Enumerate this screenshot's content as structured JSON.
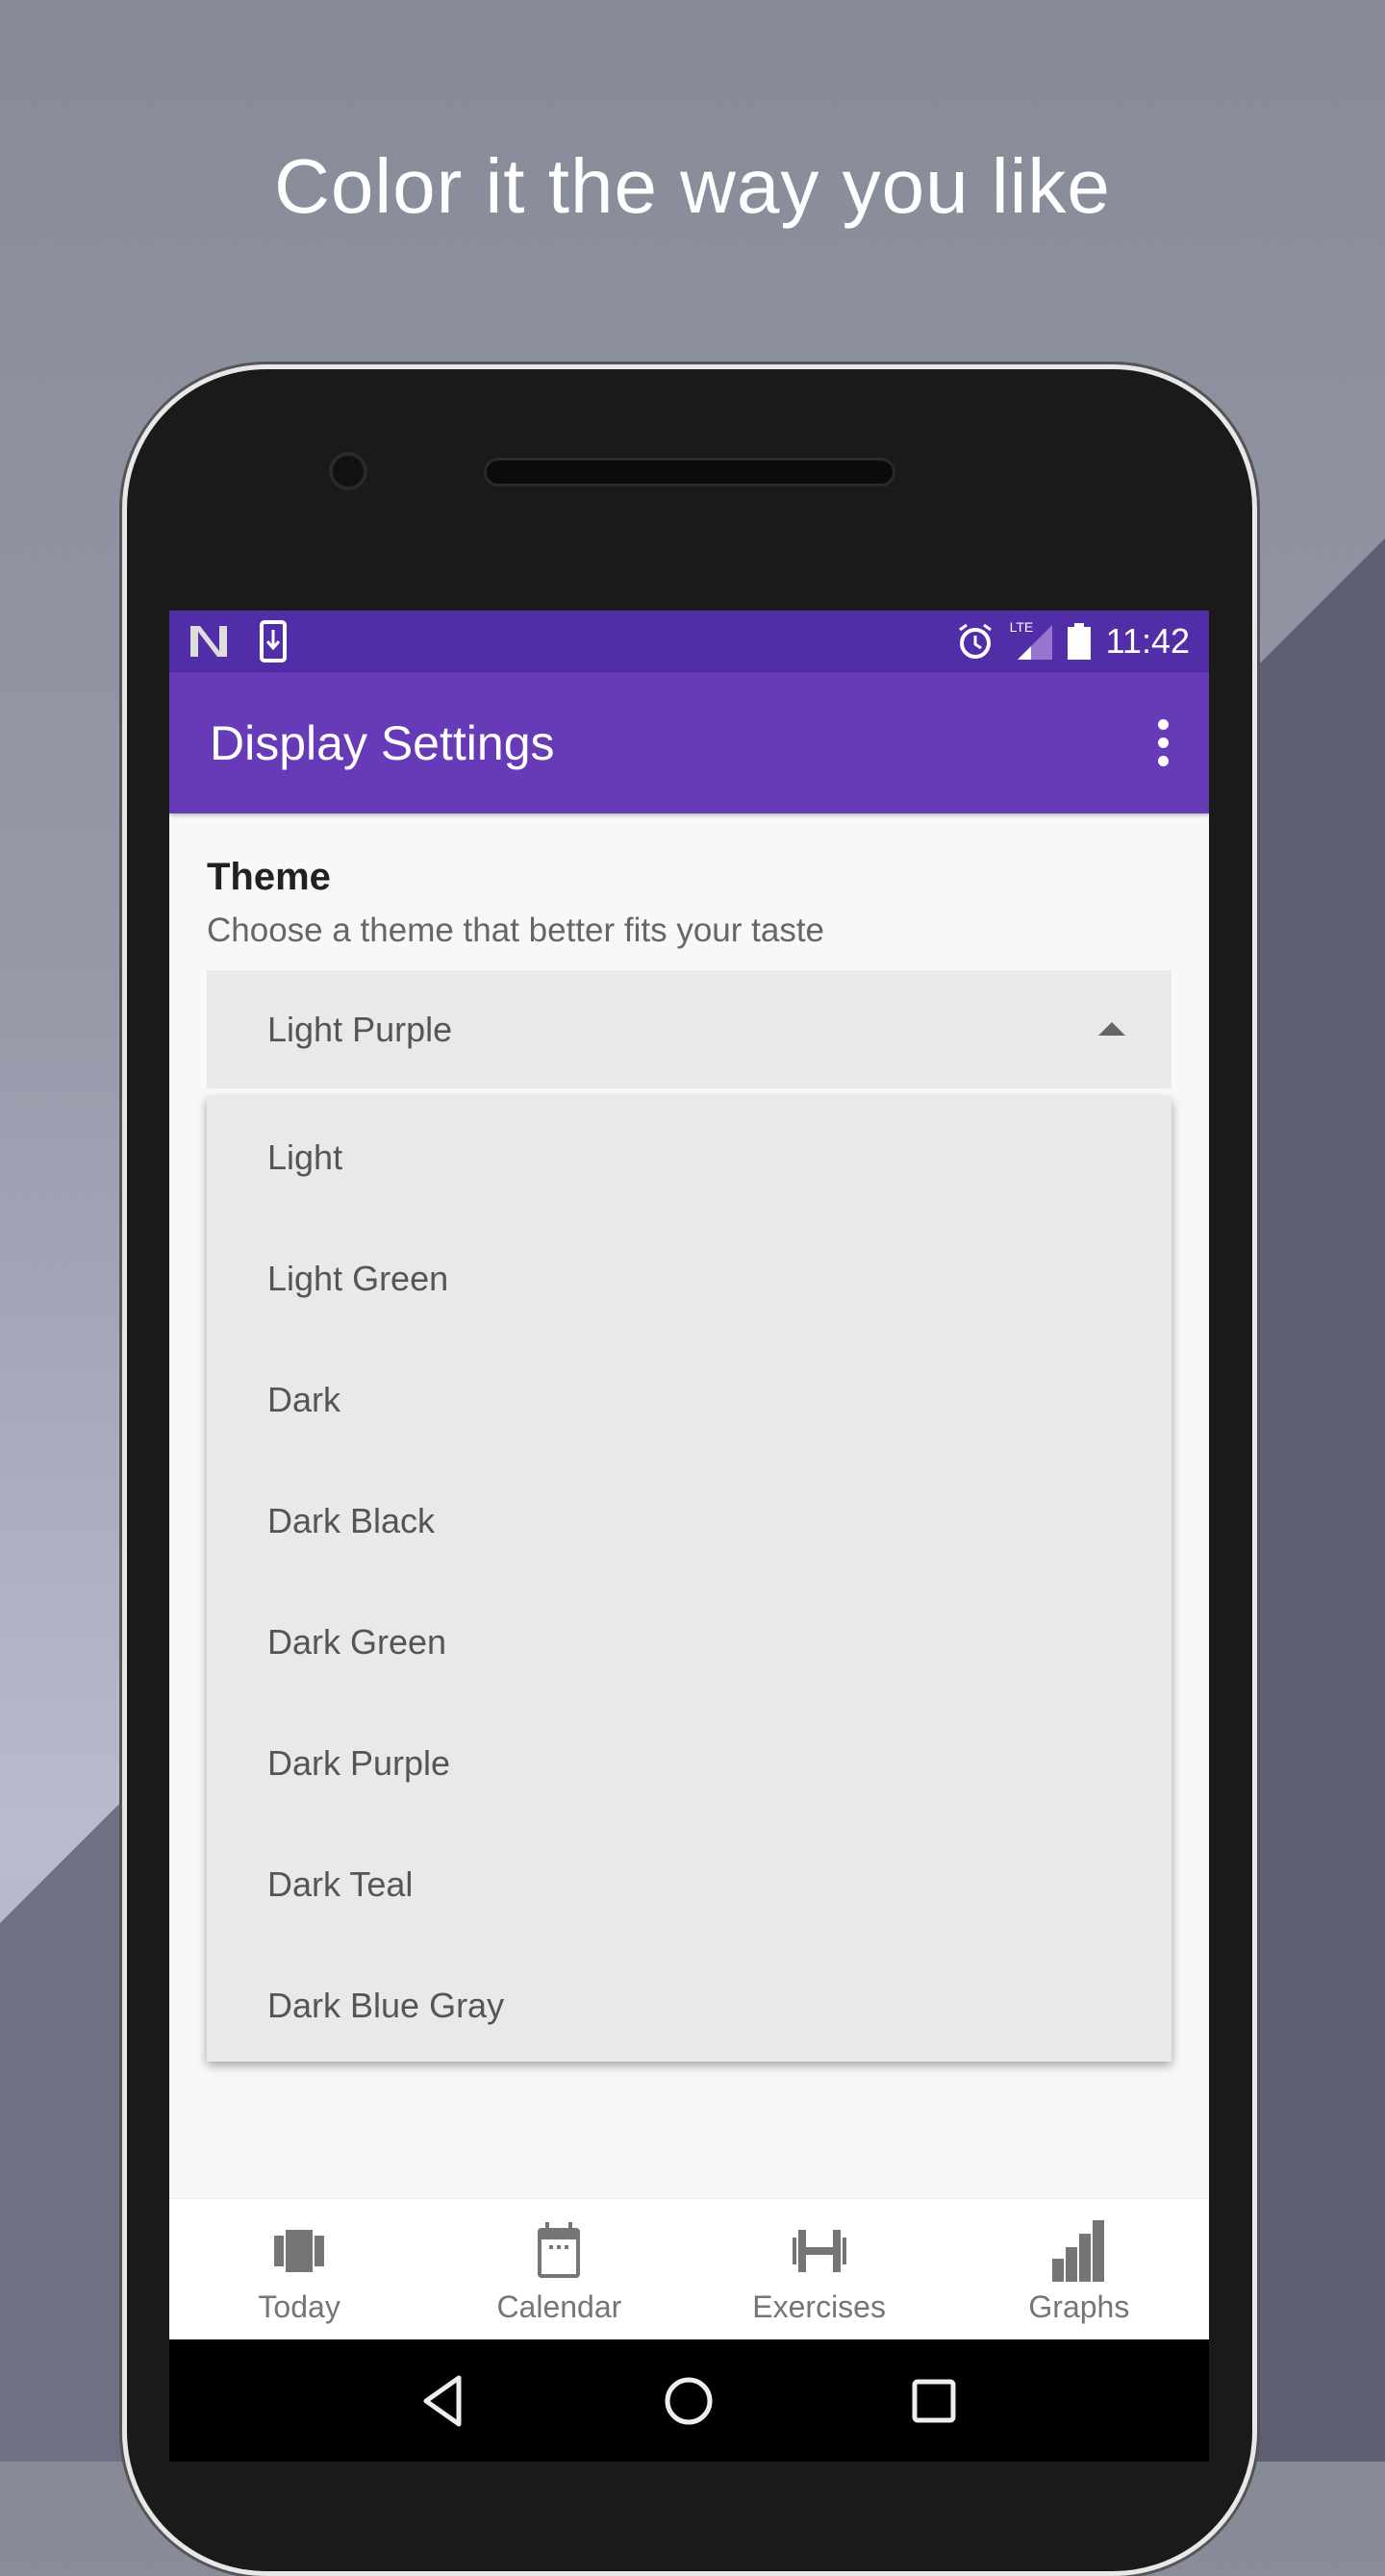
{
  "headline": "Color it the way you like",
  "status": {
    "time": "11:42",
    "network": "LTE"
  },
  "appbar": {
    "title": "Display Settings"
  },
  "theme": {
    "title": "Theme",
    "subtitle": "Choose a theme that better fits your taste",
    "selected": "Light Purple",
    "options": [
      "Light",
      "Light Green",
      "Dark",
      "Dark Black",
      "Dark Green",
      "Dark Purple",
      "Dark Teal",
      "Dark Blue Gray"
    ]
  },
  "bottom_nav": [
    {
      "label": "Today",
      "icon": "today-icon"
    },
    {
      "label": "Calendar",
      "icon": "calendar-icon"
    },
    {
      "label": "Exercises",
      "icon": "dumbbell-icon"
    },
    {
      "label": "Graphs",
      "icon": "bar-chart-icon"
    }
  ],
  "colors": {
    "status": "#512da8",
    "appbar": "#673ab7"
  }
}
